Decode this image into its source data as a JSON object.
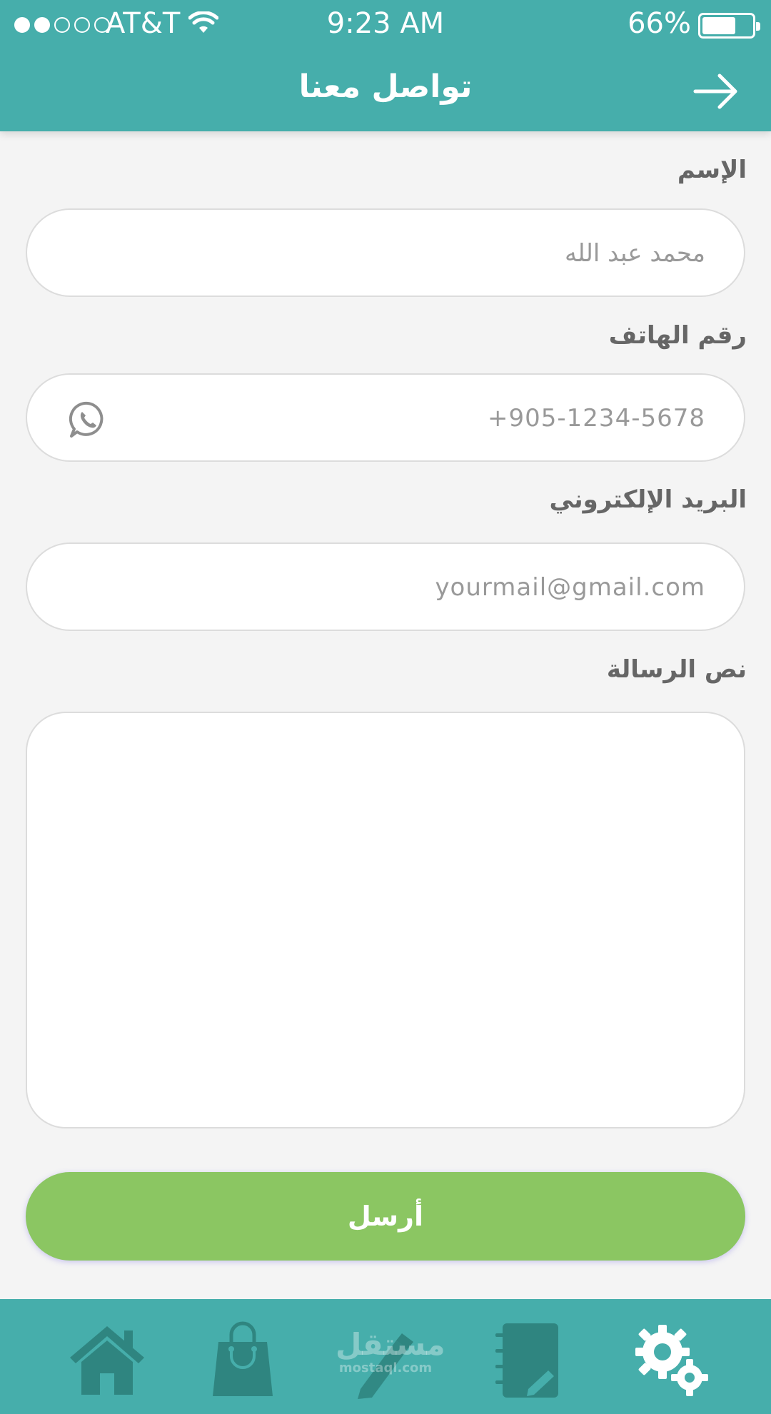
{
  "status_bar": {
    "carrier": "AT&T",
    "time": "9:23 AM",
    "battery": "66%",
    "battery_level": 0.66,
    "signal_bars": 2
  },
  "header": {
    "title": "تواصل معنا",
    "back_icon": "arrow-right-icon"
  },
  "form": {
    "name": {
      "label": "الإسم",
      "placeholder": "محمد عبد الله"
    },
    "phone": {
      "label": "رقم الهاتف",
      "placeholder": "+905-1234-5678",
      "icon": "whatsapp-icon"
    },
    "email": {
      "label": "البريد الإلكتروني",
      "placeholder": "yourmail@gmail.com"
    },
    "message": {
      "label": "نص الرسالة",
      "placeholder": ""
    },
    "submit_label": "أرسل"
  },
  "tabbar": {
    "items": [
      "home-icon",
      "shopping-bag-icon",
      "edit-pen-icon",
      "notebook-icon",
      "settings-gears-icon"
    ],
    "active": "settings-gears-icon",
    "watermark_ar": "مستقل",
    "watermark_en": "mostaql.com"
  },
  "colors": {
    "primary": "#46aeab",
    "submit": "#8bc662",
    "inactive_icon": "#2f8580",
    "background": "#f4f4f4"
  }
}
